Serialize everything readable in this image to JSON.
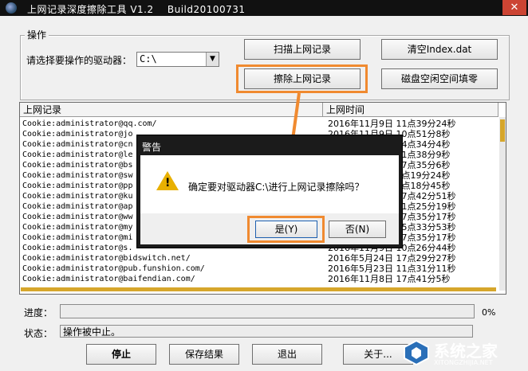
{
  "window": {
    "title": "上网记录深度擦除工具 V1.2    Build20100731"
  },
  "group": {
    "label": "操作",
    "drive_label": "请选择要操作的驱动器：",
    "drive_value": "C:\\"
  },
  "buttons": {
    "scan": "扫描上网记录",
    "clear_index": "清空Index.dat",
    "erase": "擦除上网记录",
    "fill_free": "磁盘空闲空间填零",
    "stop": "停止",
    "save": "保存结果",
    "exit": "退出",
    "about": "关于..."
  },
  "list": {
    "col1": "上网记录",
    "col2": "上网时间",
    "rows": [
      {
        "rec": "Cookie:administrator@qq.com/",
        "time": "2016年11月9日  11点39分24秒"
      },
      {
        "rec": "Cookie:administrator@jo",
        "time": "2016年11月9日  10点51分8秒"
      },
      {
        "rec": "Cookie:administrator@cn",
        "time": "2016年11月9日  14点34分4秒"
      },
      {
        "rec": "Cookie:administrator@le",
        "time": "2016年11月9日  11点38分9秒"
      },
      {
        "rec": "Cookie:administrator@bs",
        "time": "2016年11月9日  17点35分6秒"
      },
      {
        "rec": "Cookie:administrator@sw",
        "time": "2016年11月9日  9点19分24秒"
      },
      {
        "rec": "Cookie:administrator@pp",
        "time": "2016年11月9日  9点18分45秒"
      },
      {
        "rec": "Cookie:administrator@ku",
        "time": "2016年11月9日  17点42分51秒"
      },
      {
        "rec": "Cookie:administrator@ap",
        "time": "2016年11月9日  11点25分19秒"
      },
      {
        "rec": "Cookie:administrator@ww",
        "time": "2016年11月9日  17点35分17秒"
      },
      {
        "rec": "Cookie:administrator@my",
        "time": "2016年11月9日  15点33分53秒"
      },
      {
        "rec": "Cookie:administrator@mi",
        "time": "2016年11月9日  17点35分17秒"
      },
      {
        "rec": "Cookie:administrator@s.",
        "time": "2016年11月9日  10点26分44秒"
      },
      {
        "rec": "Cookie:administrator@bidswitch.net/",
        "time": "2016年5月24日  17点29分27秒"
      },
      {
        "rec": "Cookie:administrator@pub.funshion.com/",
        "time": "2016年5月23日  11点31分11秒"
      },
      {
        "rec": "Cookie:administrator@baifendian.com/",
        "time": "2016年11月8日  17点41分5秒"
      }
    ]
  },
  "status": {
    "progress_label": "进度：",
    "progress_value": 0,
    "progress_text": "0%",
    "status_label": "状态：",
    "status_text": "操作被中止。"
  },
  "dialog": {
    "title": "警告",
    "message": "确定要对驱动器C:\\进行上网记录擦除吗？",
    "yes": "是(Y)",
    "no": "否(N)"
  },
  "watermark": {
    "text1": "系统之家",
    "text2": "XITONGZHIJIA.NET"
  },
  "colors": {
    "accent": "#f08a30",
    "scrollbar": "#d6a62b",
    "title_bg": "#111111"
  }
}
